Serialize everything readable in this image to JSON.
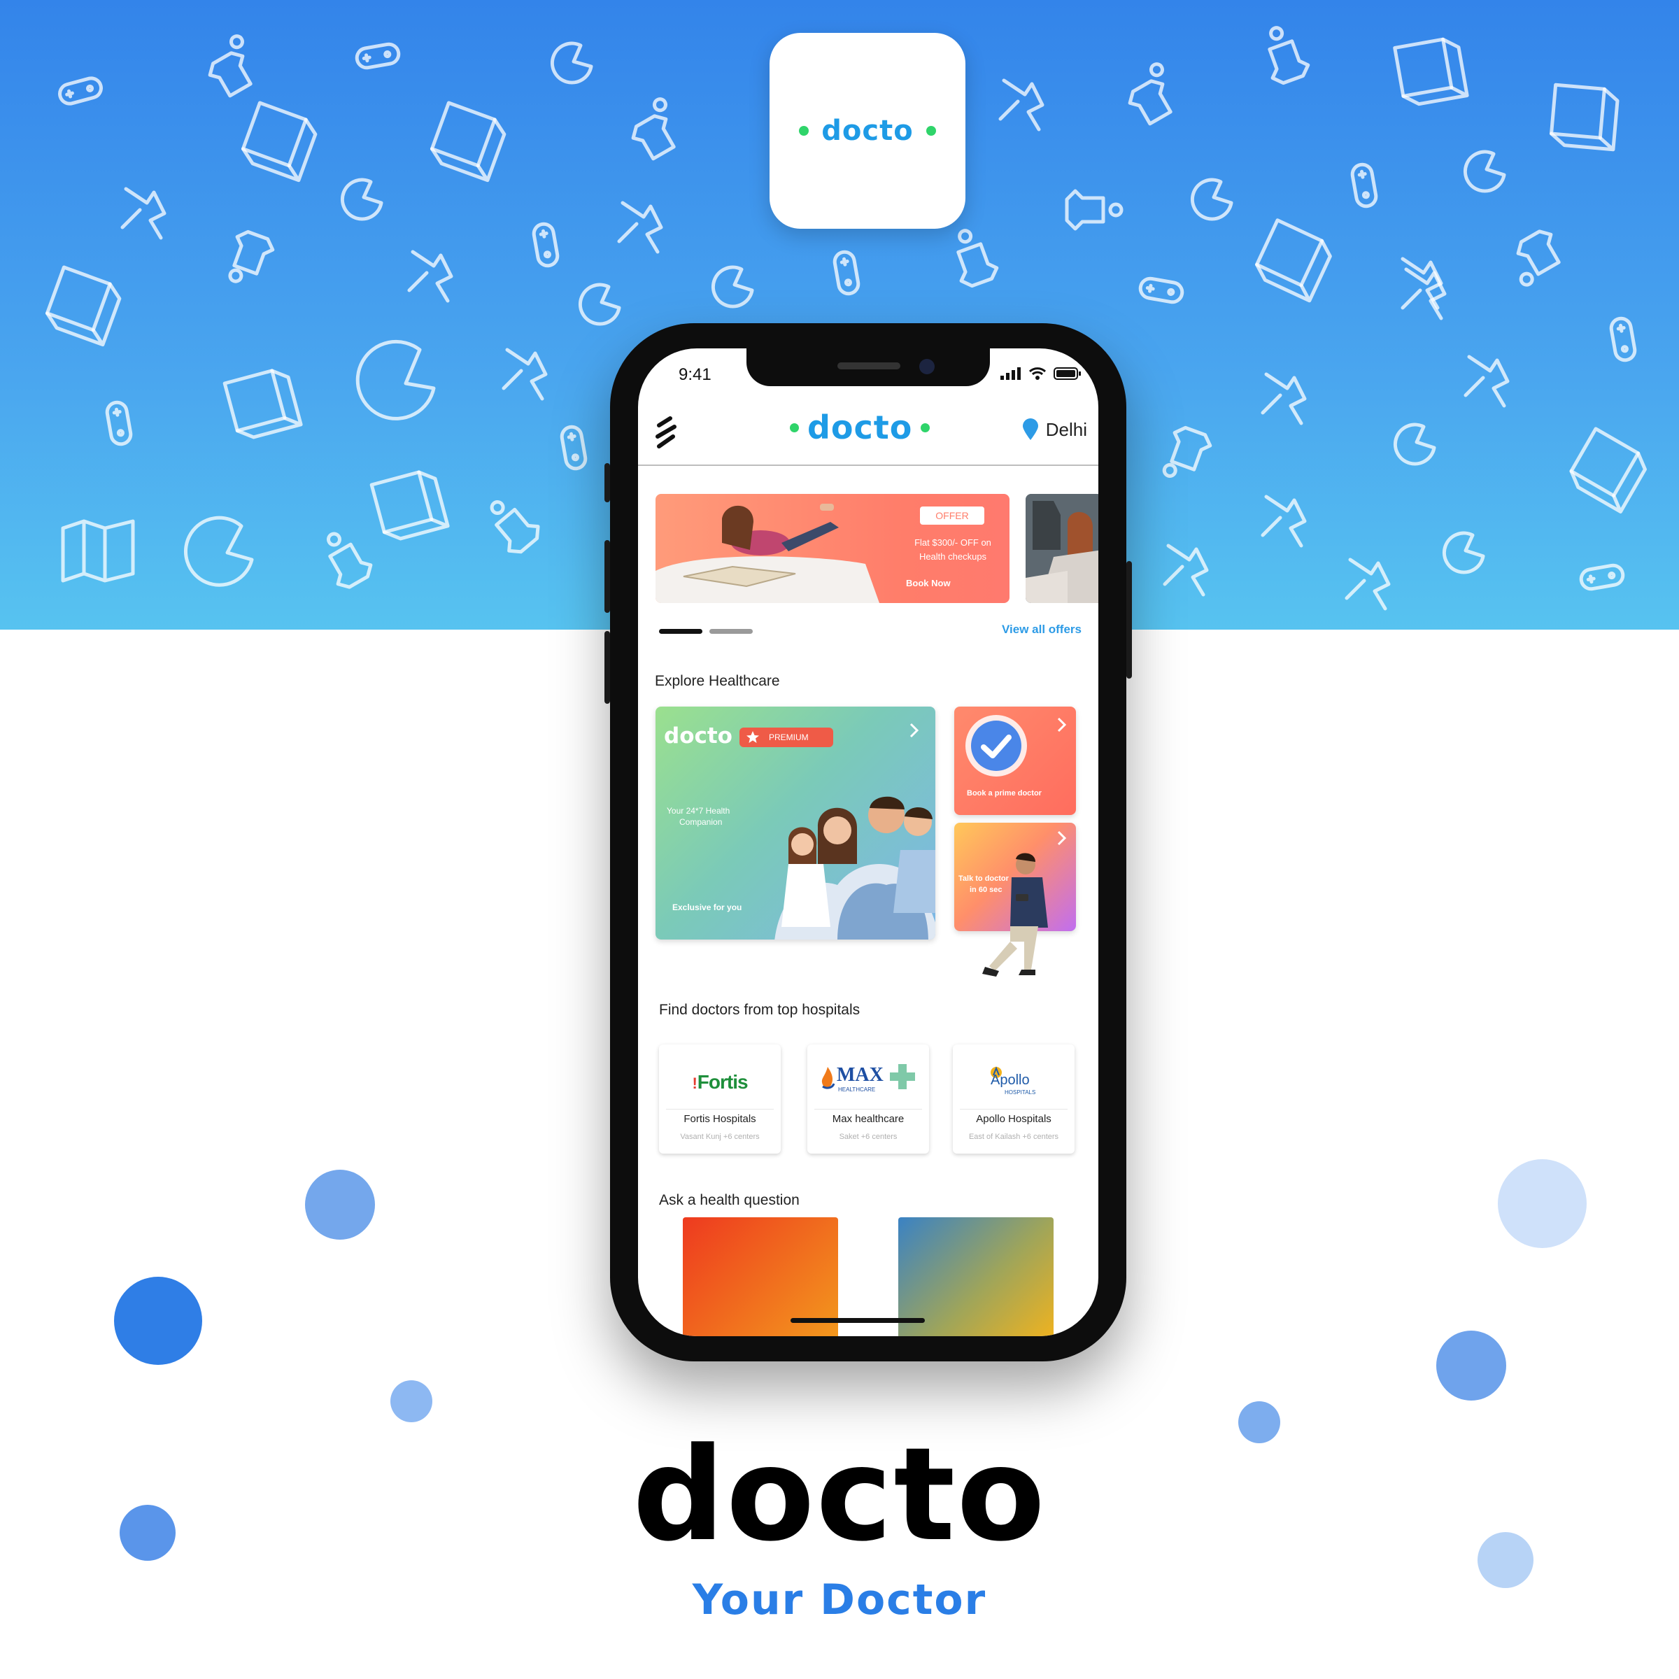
{
  "app_icon": {
    "brand": "docto"
  },
  "status_bar": {
    "time": "9:41"
  },
  "header": {
    "brand": "docto",
    "location": "Delhi"
  },
  "offer_banner": {
    "badge": "OFFER",
    "line1": "Flat $300/- OFF on",
    "line2": "Health checkups",
    "cta": "Book Now"
  },
  "offers": {
    "view_all": "View all offers"
  },
  "explore": {
    "title": "Explore Healthcare",
    "premium_card": {
      "brand": "docto",
      "badge": "PREMIUM",
      "tagline_line1": "Your 24*7 Health",
      "tagline_line2": "Companion",
      "footer": "Exclusive for you"
    },
    "prime_card": {
      "label": "Book a prime doctor"
    },
    "talk_card": {
      "line1": "Talk to doctor",
      "line2": "in 60 sec"
    }
  },
  "hospitals": {
    "title": "Find doctors from top hospitals",
    "items": [
      {
        "logo": "Fortis",
        "name": "Fortis Hospitals",
        "sub": "Vasant Kunj +6 centers"
      },
      {
        "logo": "MAX",
        "logo_sub": "HEALTHCARE",
        "name": "Max healthcare",
        "sub": "Saket +6 centers"
      },
      {
        "logo": "Apollo",
        "logo_sub": "HOSPITALS",
        "name": "Apollo Hospitals",
        "sub": "East of Kailash +6 centers"
      }
    ]
  },
  "ask": {
    "title": "Ask a health question"
  },
  "brand_title": "docto",
  "tagline": "Your Doctor",
  "colors": {
    "brand_blue": "#1e9be6",
    "brand_green": "#2fd46a",
    "hero_top": "#3384ea",
    "hero_bottom": "#57c3f0",
    "offer_coral": "#ff7f66",
    "tagline_blue": "#2a7ee6"
  },
  "icons": [
    "menu-icon",
    "location-pin-icon",
    "signal-icon",
    "wifi-icon",
    "battery-icon",
    "chevron-right-icon",
    "check-badge-icon",
    "star-icon",
    "gamepad-icon",
    "pacman-icon",
    "cube-icon",
    "map-icon",
    "shirt-icon",
    "bodybuilder-icon"
  ]
}
